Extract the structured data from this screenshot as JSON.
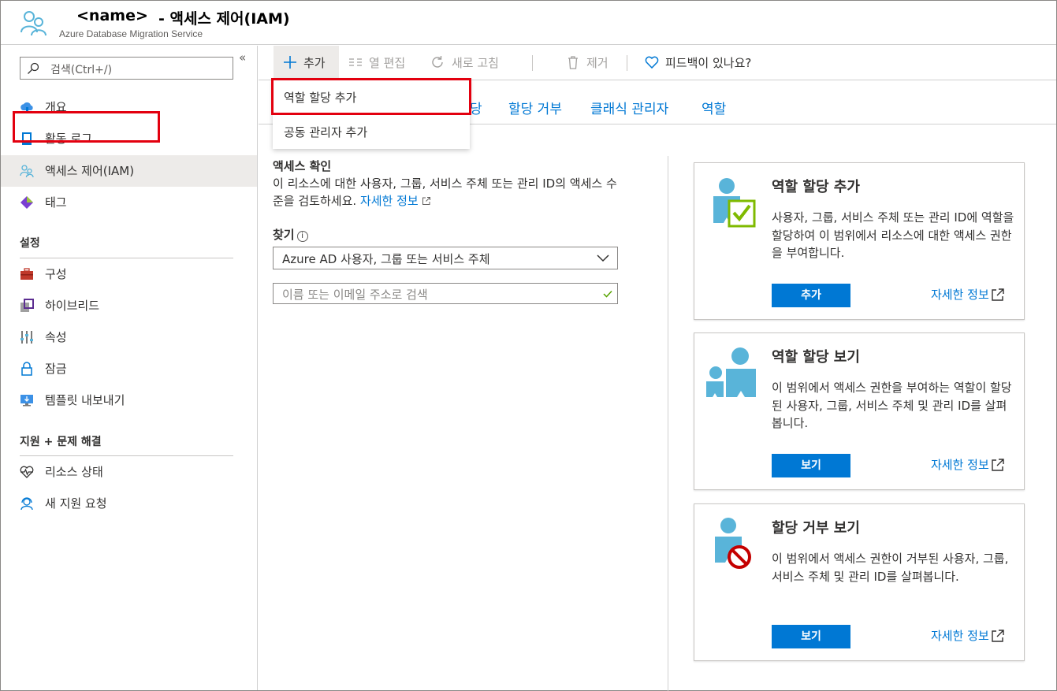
{
  "header": {
    "name": "<name>",
    "title": "- 액세스 제어(IAM)",
    "subtitle": "Azure Database Migration Service",
    "icon": "users-icon"
  },
  "sidebar": {
    "collapse_glyph": "«",
    "search_placeholder": "검색(Ctrl+/)",
    "items": [
      {
        "label": "개요",
        "icon": "cloud-overview-icon"
      },
      {
        "label": "활동 로그",
        "icon": "activity-log-icon"
      },
      {
        "label": "액세스 제어(IAM)",
        "icon": "users-icon",
        "active": true
      },
      {
        "label": "태그",
        "icon": "tag-icon"
      }
    ],
    "sections": [
      {
        "title": "설정",
        "items": [
          {
            "label": "구성",
            "icon": "toolbox-icon"
          },
          {
            "label": "하이브리드",
            "icon": "hybrid-icon"
          },
          {
            "label": "속성",
            "icon": "properties-icon"
          },
          {
            "label": "잠금",
            "icon": "lock-icon"
          },
          {
            "label": "템플릿 내보내기",
            "icon": "export-template-icon"
          }
        ]
      },
      {
        "title": "지원 + 문제 해결",
        "items": [
          {
            "label": "리소스 상태",
            "icon": "heart-pulse-icon"
          },
          {
            "label": "새 지원 요청",
            "icon": "support-person-icon"
          }
        ]
      }
    ]
  },
  "toolbar": {
    "add_label": "추가",
    "edit_columns_label": "열 편집",
    "refresh_label": "새로 고침",
    "remove_label": "제거",
    "feedback_label": "피드백이 있나요?"
  },
  "dropdown": {
    "items": [
      "역할 할당 추가",
      "공동 관리자 추가"
    ]
  },
  "tabs": [
    "당",
    "할당 거부",
    "클래식 관리자",
    "역할"
  ],
  "check_access": {
    "title": "액세스 확인",
    "desc": "이 리소스에 대한 사용자, 그룹, 서비스 주체 또는 관리 ID의 액세스 수준을 검토하세요.",
    "learn_more": "자세한 정보",
    "find_label": "찾기",
    "find_value": "Azure AD 사용자, 그룹 또는 서비스 주체",
    "search_placeholder": "이름 또는 이메일 주소로 검색"
  },
  "cards": [
    {
      "title": "역할 할당 추가",
      "desc": "사용자, 그룹, 서비스 주체 또는 관리 ID에 역할을 할당하여 이 범위에서 리소스에 대한 액세스 권한을 부여합니다.",
      "button": "추가",
      "link": "자세한 정보",
      "icon": "user-checkmark-icon"
    },
    {
      "title": "역할 할당 보기",
      "desc": "이 범위에서 액세스 권한을 부여하는 역할이 할당된 사용자, 그룹, 서비스 주체 및 관리 ID를 살펴봅니다.",
      "button": "보기",
      "link": "자세한 정보",
      "icon": "users-group-icon"
    },
    {
      "title": "할당 거부 보기",
      "desc": "이 범위에서 액세스 권한이 거부된 사용자, 그룹, 서비스 주체 및 관리 ID를 살펴봅니다.",
      "button": "보기",
      "link": "자세한 정보",
      "icon": "user-denied-icon"
    }
  ],
  "colors": {
    "accent": "#0078d4",
    "highlight": "#e3000f",
    "icon_blue": "#59b4d9"
  }
}
